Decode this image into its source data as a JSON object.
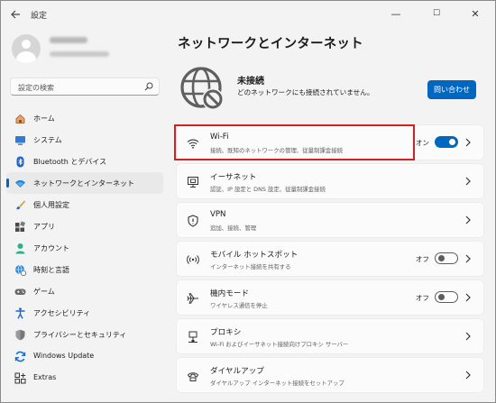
{
  "window": {
    "title": "設定",
    "minimize": "—",
    "maximize": "☐",
    "close": "✕"
  },
  "sidebar": {
    "search_placeholder": "設定の検索",
    "items": [
      {
        "label": "ホーム",
        "icon": "home-icon"
      },
      {
        "label": "システム",
        "icon": "system-icon"
      },
      {
        "label": "Bluetooth とデバイス",
        "icon": "bluetooth-icon"
      },
      {
        "label": "ネットワークとインターネット",
        "icon": "network-icon",
        "active": true
      },
      {
        "label": "個人用設定",
        "icon": "paintbrush-icon"
      },
      {
        "label": "アプリ",
        "icon": "apps-icon"
      },
      {
        "label": "アカウント",
        "icon": "account-icon"
      },
      {
        "label": "時刻と言語",
        "icon": "globe-clock-icon"
      },
      {
        "label": "ゲーム",
        "icon": "gamepad-icon"
      },
      {
        "label": "アクセシビリティ",
        "icon": "accessibility-icon"
      },
      {
        "label": "プライバシーとセキュリティ",
        "icon": "shield-icon"
      },
      {
        "label": "Windows Update",
        "icon": "update-icon"
      },
      {
        "label": "Extras",
        "icon": "extras-icon"
      }
    ]
  },
  "main": {
    "title": "ネットワークとインターネット",
    "status": {
      "title": "未接続",
      "description": "どのネットワークにも接続されていません。",
      "button": "問い合わせ"
    },
    "cards": [
      {
        "title": "Wi-Fi",
        "subtitle": "接続、既知のネットワークの管理、従量制課金接続",
        "icon": "wifi-icon",
        "toggle_label": "オン",
        "toggle": "on"
      },
      {
        "title": "イーサネット",
        "subtitle": "認証、IP 設定と DNS 設定、従量制課金接続",
        "icon": "ethernet-icon"
      },
      {
        "title": "VPN",
        "subtitle": "追加、接続、管理",
        "icon": "vpn-shield-icon"
      },
      {
        "title": "モバイル ホットスポット",
        "subtitle": "インターネット接続を共有する",
        "icon": "hotspot-icon",
        "toggle_label": "オフ",
        "toggle": "off"
      },
      {
        "title": "機内モード",
        "subtitle": "ワイヤレス通信を停止",
        "icon": "airplane-icon",
        "toggle_label": "オフ",
        "toggle": "off"
      },
      {
        "title": "プロキシ",
        "subtitle": "Wi-Fi およびイーサネット接続向けプロキシ サーバー",
        "icon": "proxy-icon"
      },
      {
        "title": "ダイヤルアップ",
        "subtitle": "ダイヤルアップ インターネット接続をセットアップ",
        "icon": "dialup-icon"
      }
    ]
  },
  "colors": {
    "accent": "#0067c0",
    "highlight": "#d42020",
    "background": "#f3f3f3"
  }
}
